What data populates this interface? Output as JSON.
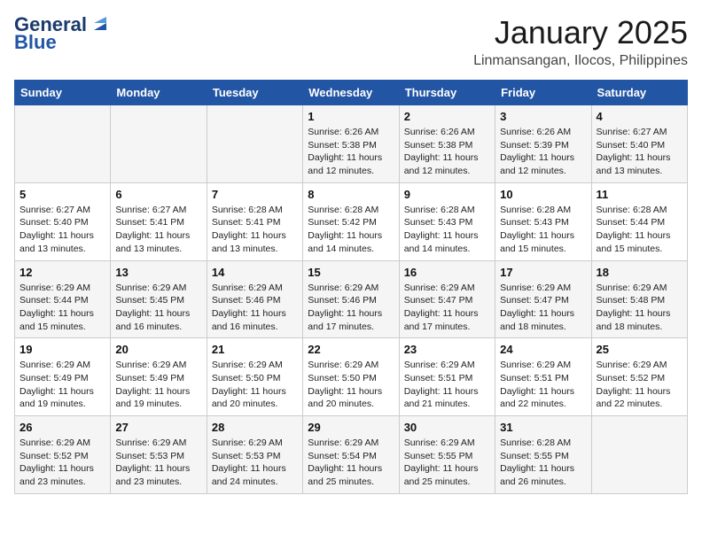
{
  "header": {
    "logo_line1": "General",
    "logo_line2": "Blue",
    "month": "January 2025",
    "location": "Linmansangan, Ilocos, Philippines"
  },
  "days_of_week": [
    "Sunday",
    "Monday",
    "Tuesday",
    "Wednesday",
    "Thursday",
    "Friday",
    "Saturday"
  ],
  "weeks": [
    [
      {
        "day": "",
        "info": ""
      },
      {
        "day": "",
        "info": ""
      },
      {
        "day": "",
        "info": ""
      },
      {
        "day": "1",
        "info": "Sunrise: 6:26 AM\nSunset: 5:38 PM\nDaylight: 11 hours and 12 minutes."
      },
      {
        "day": "2",
        "info": "Sunrise: 6:26 AM\nSunset: 5:38 PM\nDaylight: 11 hours and 12 minutes."
      },
      {
        "day": "3",
        "info": "Sunrise: 6:26 AM\nSunset: 5:39 PM\nDaylight: 11 hours and 12 minutes."
      },
      {
        "day": "4",
        "info": "Sunrise: 6:27 AM\nSunset: 5:40 PM\nDaylight: 11 hours and 13 minutes."
      }
    ],
    [
      {
        "day": "5",
        "info": "Sunrise: 6:27 AM\nSunset: 5:40 PM\nDaylight: 11 hours and 13 minutes."
      },
      {
        "day": "6",
        "info": "Sunrise: 6:27 AM\nSunset: 5:41 PM\nDaylight: 11 hours and 13 minutes."
      },
      {
        "day": "7",
        "info": "Sunrise: 6:28 AM\nSunset: 5:41 PM\nDaylight: 11 hours and 13 minutes."
      },
      {
        "day": "8",
        "info": "Sunrise: 6:28 AM\nSunset: 5:42 PM\nDaylight: 11 hours and 14 minutes."
      },
      {
        "day": "9",
        "info": "Sunrise: 6:28 AM\nSunset: 5:43 PM\nDaylight: 11 hours and 14 minutes."
      },
      {
        "day": "10",
        "info": "Sunrise: 6:28 AM\nSunset: 5:43 PM\nDaylight: 11 hours and 15 minutes."
      },
      {
        "day": "11",
        "info": "Sunrise: 6:28 AM\nSunset: 5:44 PM\nDaylight: 11 hours and 15 minutes."
      }
    ],
    [
      {
        "day": "12",
        "info": "Sunrise: 6:29 AM\nSunset: 5:44 PM\nDaylight: 11 hours and 15 minutes."
      },
      {
        "day": "13",
        "info": "Sunrise: 6:29 AM\nSunset: 5:45 PM\nDaylight: 11 hours and 16 minutes."
      },
      {
        "day": "14",
        "info": "Sunrise: 6:29 AM\nSunset: 5:46 PM\nDaylight: 11 hours and 16 minutes."
      },
      {
        "day": "15",
        "info": "Sunrise: 6:29 AM\nSunset: 5:46 PM\nDaylight: 11 hours and 17 minutes."
      },
      {
        "day": "16",
        "info": "Sunrise: 6:29 AM\nSunset: 5:47 PM\nDaylight: 11 hours and 17 minutes."
      },
      {
        "day": "17",
        "info": "Sunrise: 6:29 AM\nSunset: 5:47 PM\nDaylight: 11 hours and 18 minutes."
      },
      {
        "day": "18",
        "info": "Sunrise: 6:29 AM\nSunset: 5:48 PM\nDaylight: 11 hours and 18 minutes."
      }
    ],
    [
      {
        "day": "19",
        "info": "Sunrise: 6:29 AM\nSunset: 5:49 PM\nDaylight: 11 hours and 19 minutes."
      },
      {
        "day": "20",
        "info": "Sunrise: 6:29 AM\nSunset: 5:49 PM\nDaylight: 11 hours and 19 minutes."
      },
      {
        "day": "21",
        "info": "Sunrise: 6:29 AM\nSunset: 5:50 PM\nDaylight: 11 hours and 20 minutes."
      },
      {
        "day": "22",
        "info": "Sunrise: 6:29 AM\nSunset: 5:50 PM\nDaylight: 11 hours and 20 minutes."
      },
      {
        "day": "23",
        "info": "Sunrise: 6:29 AM\nSunset: 5:51 PM\nDaylight: 11 hours and 21 minutes."
      },
      {
        "day": "24",
        "info": "Sunrise: 6:29 AM\nSunset: 5:51 PM\nDaylight: 11 hours and 22 minutes."
      },
      {
        "day": "25",
        "info": "Sunrise: 6:29 AM\nSunset: 5:52 PM\nDaylight: 11 hours and 22 minutes."
      }
    ],
    [
      {
        "day": "26",
        "info": "Sunrise: 6:29 AM\nSunset: 5:52 PM\nDaylight: 11 hours and 23 minutes."
      },
      {
        "day": "27",
        "info": "Sunrise: 6:29 AM\nSunset: 5:53 PM\nDaylight: 11 hours and 23 minutes."
      },
      {
        "day": "28",
        "info": "Sunrise: 6:29 AM\nSunset: 5:53 PM\nDaylight: 11 hours and 24 minutes."
      },
      {
        "day": "29",
        "info": "Sunrise: 6:29 AM\nSunset: 5:54 PM\nDaylight: 11 hours and 25 minutes."
      },
      {
        "day": "30",
        "info": "Sunrise: 6:29 AM\nSunset: 5:55 PM\nDaylight: 11 hours and 25 minutes."
      },
      {
        "day": "31",
        "info": "Sunrise: 6:28 AM\nSunset: 5:55 PM\nDaylight: 11 hours and 26 minutes."
      },
      {
        "day": "",
        "info": ""
      }
    ]
  ]
}
